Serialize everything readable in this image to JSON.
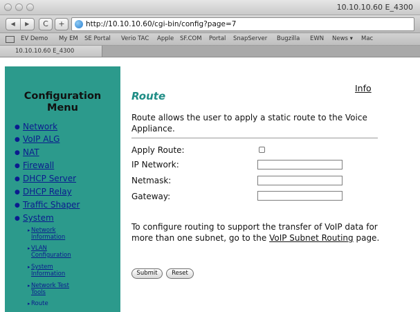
{
  "window": {
    "title": "10.10.10.60 E_4300"
  },
  "toolbar": {
    "back": "◀",
    "forward": "▶",
    "reload": "C",
    "add": "+",
    "url": "http://10.10.10.60/cgi-bin/config?page=7"
  },
  "bookmarks": [
    "EV Demo",
    "My EM",
    "SE Portal",
    "Verio TAC",
    "Apple",
    "SF.COM",
    "Portal",
    "SnapServer",
    "Bugzilla",
    "EWN",
    "News ▾",
    "Mac"
  ],
  "tab": {
    "title": "10.10.10.60 E_4300"
  },
  "sidebar": {
    "title_line1": "Configuration",
    "title_line2": "Menu",
    "items": [
      "Network",
      "VoIP ALG",
      "NAT",
      "Firewall",
      "DHCP Server",
      "DHCP Relay",
      "Traffic Shaper",
      "System"
    ],
    "subitems": [
      {
        "line1": "Network",
        "line2": "Information"
      },
      {
        "line1": "VLAN",
        "line2": "Configuration"
      },
      {
        "line1": "System",
        "line2": "Information"
      },
      {
        "line1": "Network Test",
        "line2": "Tools"
      }
    ],
    "current": "Route"
  },
  "main": {
    "info_link": "Info",
    "heading": "Route",
    "description": "Route allows the user to apply a static route to the Voice Appliance.",
    "fields": {
      "apply_route": "Apply Route:",
      "ip_network": "IP Network:",
      "netmask": "Netmask:",
      "gateway": "Gateway:"
    },
    "values": {
      "ip_network": "",
      "netmask": "",
      "gateway": "",
      "apply_route_checked": false
    },
    "note_prefix": "To configure routing to support the transfer of VoIP data for more than one subnet, go to the ",
    "note_link": "VoIP Subnet Routing",
    "note_suffix": " page.",
    "submit": "Submit",
    "reset": "Reset"
  },
  "colors": {
    "sidebar_bg": "#2c9a8c",
    "heading": "#1f8d86",
    "link": "#0b1b8e"
  }
}
